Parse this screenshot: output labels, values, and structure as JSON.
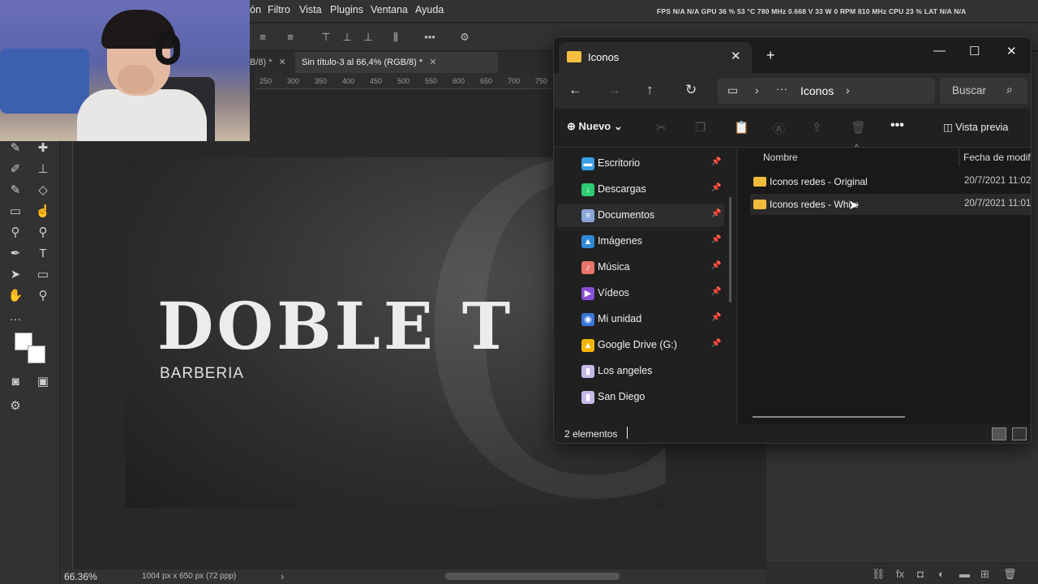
{
  "photoshop": {
    "menu": [
      "ón",
      "Filtro",
      "Vista",
      "Plugins",
      "Ventana",
      "Ayuda"
    ],
    "perf_readout": "FPS  N/A  N/A    GPU 36 % 53 °C 780 MHz 0.668 V 33 W 0 RPM 810 MHz    CPU 23 %    LAT  N/A  N/A",
    "tabs": [
      {
        "label": "B/8) *",
        "close": "✕"
      },
      {
        "label": "Sin título-3 al 66,4% (RGB/8) *",
        "close": "✕"
      }
    ],
    "ruler_ticks": [
      "250",
      "300",
      "350",
      "400",
      "450",
      "500",
      "550",
      "600",
      "650",
      "700",
      "750"
    ],
    "canvas": {
      "title": "DOBLE T",
      "subtitle": "BARBERIA",
      "watermark": "C"
    },
    "status": {
      "zoom": "66.36%",
      "doc_info": "1004 px x 650 px (72 ppp)",
      "arrow": "›"
    }
  },
  "explorer": {
    "tab_title": "Iconos",
    "tab_close": "✕",
    "new_tab": "+",
    "window_buttons": {
      "minimize": "—",
      "maximize": "☐",
      "close": "✕"
    },
    "nav": {
      "back": "←",
      "forward": "→",
      "up": "↑",
      "refresh": "↻"
    },
    "address": {
      "pc_icon": "▭",
      "sep": "›",
      "dots": "···",
      "current": "Iconos"
    },
    "search_placeholder": "Buscar",
    "search_icon": "⌕",
    "commands": {
      "new": "Nuevo",
      "more": "•••",
      "preview": "Vista previa"
    },
    "sidebar": [
      {
        "label": "Escritorio",
        "icon": "desktop-icon",
        "color": "#3aa0e8",
        "glyph": "▬",
        "pinned": true
      },
      {
        "label": "Descargas",
        "icon": "download-icon",
        "color": "#2ecc71",
        "glyph": "↓",
        "pinned": true
      },
      {
        "label": "Documentos",
        "icon": "document-icon",
        "color": "#8aa6d8",
        "glyph": "≡",
        "pinned": true,
        "selected": true
      },
      {
        "label": "Imágenes",
        "icon": "pictures-icon",
        "color": "#2f88d6",
        "glyph": "▲",
        "pinned": true
      },
      {
        "label": "Música",
        "icon": "music-icon",
        "color": "#e8746a",
        "glyph": "♪",
        "pinned": true
      },
      {
        "label": "Vídeos",
        "icon": "videos-icon",
        "color": "#8a4fd8",
        "glyph": "▶",
        "pinned": true
      },
      {
        "label": "Mi unidad",
        "icon": "drive-icon",
        "color": "#3a76d8",
        "glyph": "◉",
        "pinned": true
      },
      {
        "label": "Google Drive (G:)",
        "icon": "google-drive-icon",
        "color": "#f4b400",
        "glyph": "▲",
        "pinned": true
      },
      {
        "label": "Los angeles",
        "icon": "folder-user-icon",
        "color": "#c7b9e8",
        "glyph": "▮",
        "pinned": false
      },
      {
        "label": "San Diego",
        "icon": "folder-user-icon",
        "color": "#c7b9e8",
        "glyph": "▮",
        "pinned": false
      }
    ],
    "pin_glyph": "📌",
    "columns": {
      "name": "Nombre",
      "date": "Fecha de modif",
      "sort": "^"
    },
    "files": [
      {
        "name": "Iconos redes - Original",
        "date": "20/7/2021 11:02"
      },
      {
        "name": "Iconos redes - White",
        "date": "20/7/2021 11:01"
      }
    ],
    "status": {
      "count": "2 elementos"
    }
  },
  "colors": {
    "folder": "#f0bb3a",
    "explorer_bg": "#202020",
    "ps_bg": "#282828"
  }
}
